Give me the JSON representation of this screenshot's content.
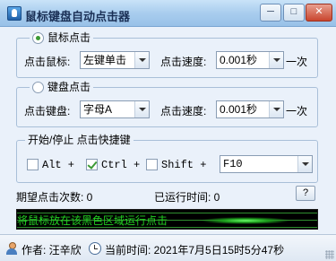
{
  "window": {
    "title": "鼠标键盘自动点击器",
    "min_label": "─",
    "max_label": "□",
    "close_label": "✕"
  },
  "mouse_group": {
    "title": "鼠标点击",
    "selected": true,
    "button_label": "点击鼠标:",
    "button_value": "左键单击",
    "speed_label": "点击速度:",
    "speed_value": "0.001秒",
    "speed_unit": "一次"
  },
  "keyboard_group": {
    "title": "键盘点击",
    "selected": false,
    "key_label": "点击键盘:",
    "key_value": "字母A",
    "speed_label": "点击速度:",
    "speed_value": "0.001秒",
    "speed_unit": "一次"
  },
  "hotkey_group": {
    "title": "开始/停止 点击快捷键",
    "alt_label": "Alt +",
    "alt_checked": false,
    "ctrl_label": "Ctrl +",
    "ctrl_checked": true,
    "shift_label": "Shift +",
    "shift_checked": false,
    "key_value": "F10"
  },
  "stats": {
    "expected_label": "期望点击次数: 0",
    "runtime_label": "已运行时间: 0",
    "mini_button_label": "?"
  },
  "hot_area": {
    "text": "将鼠标放在该黑色区域运行点击"
  },
  "status": {
    "author": "作者: 汪辛欣",
    "current_time": "当前时间: 2021年7月5日15时5分47秒"
  },
  "colors": {
    "accent_green": "#3c9a35",
    "hot_text": "#22d022"
  }
}
